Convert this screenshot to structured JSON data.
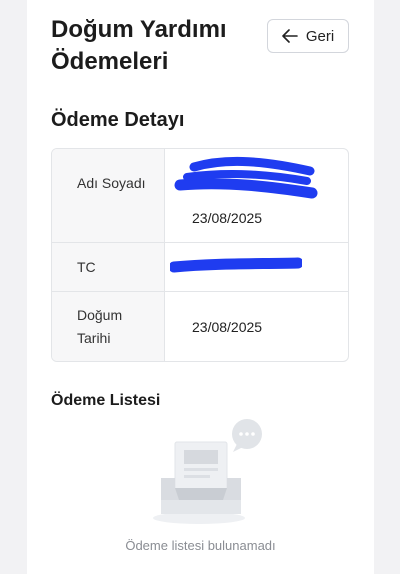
{
  "header": {
    "title": "Doğum Yardımı Ödemeleri",
    "back_label": "Geri",
    "back_icon": "arrow-left-icon"
  },
  "detail": {
    "section_title": "Ödeme Detayı",
    "rows": [
      {
        "label": "Adı Soyadı",
        "value": "23/08/2025"
      },
      {
        "label": "TC",
        "value": ""
      },
      {
        "label": "Doğum Tarihi",
        "value": "23/08/2025"
      }
    ]
  },
  "payment_list": {
    "section_title": "Ödeme Listesi",
    "empty_icon": "empty-inbox-icon",
    "empty_message": "Ödeme listesi bulunamadı"
  },
  "colors": {
    "background": "#f2f2f4",
    "card": "#ffffff",
    "redaction": "#1f3cf0",
    "border": "#e3e5e8",
    "muted_text": "#8a8d93"
  }
}
